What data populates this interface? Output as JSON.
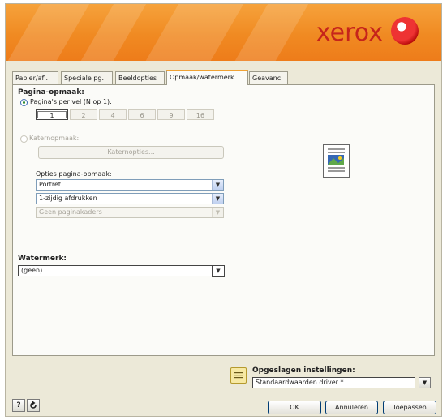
{
  "banner": {
    "logo_text": "xerox"
  },
  "tabs": [
    {
      "label": "Papier/afl."
    },
    {
      "label": "Speciale pg."
    },
    {
      "label": "Beeldopties"
    },
    {
      "label": "Opmaak/watermerk"
    },
    {
      "label": "Geavanc."
    }
  ],
  "layout": {
    "title": "Pagina-opmaak:",
    "pages_per_sheet_label": "Pagina's per vel (N op 1):",
    "nup_values": [
      "1",
      "2",
      "4",
      "6",
      "9",
      "16"
    ],
    "nup_selected": "1",
    "booklet_label": "Katernopmaak:",
    "booklet_button": "Katernopties...",
    "options_label": "Opties pagina-opmaak:",
    "orientation": "Portret",
    "sides": "1-zijdig afdrukken",
    "page_border": "Geen paginakaders"
  },
  "watermark": {
    "title": "Watermerk:",
    "value": "(geen)"
  },
  "saved_settings": {
    "title": "Opgeslagen instellingen:",
    "value": "Standaardwaarden driver *"
  },
  "footer": {
    "help": "?",
    "ok": "OK",
    "cancel": "Annuleren",
    "apply": "Toepassen"
  }
}
